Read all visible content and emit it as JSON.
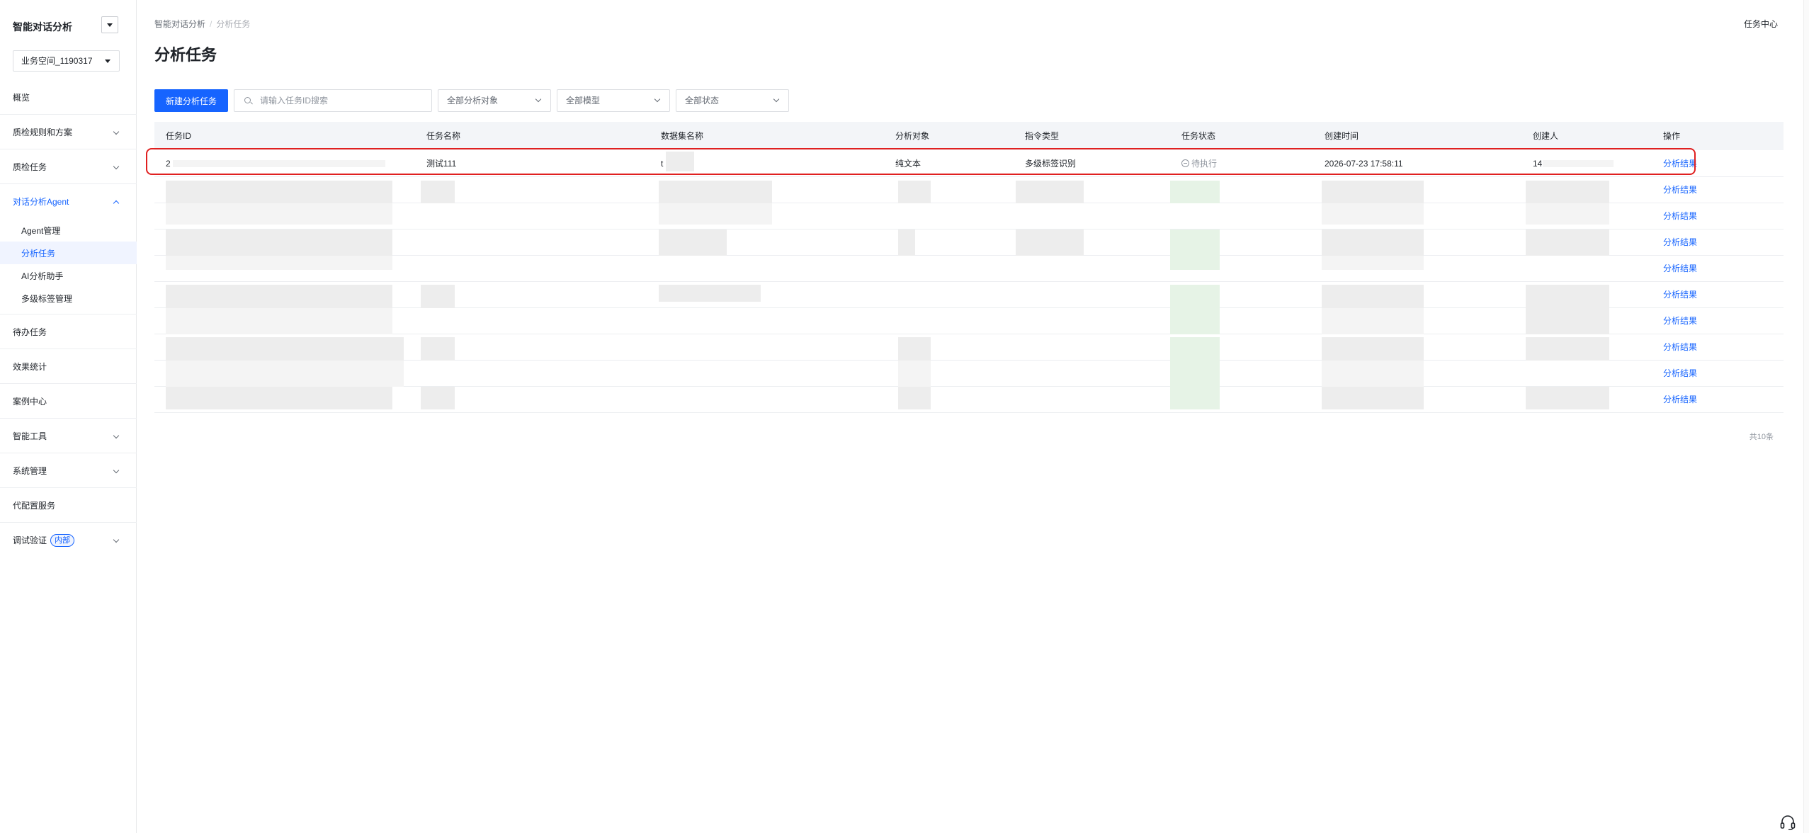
{
  "sidebar": {
    "app_title": "智能对话分析",
    "workspace": "业务空间_1190317",
    "nav": [
      {
        "label": "概览"
      },
      {
        "label": "质检规则和方案"
      },
      {
        "label": "质检任务"
      },
      {
        "label": "对话分析Agent"
      },
      {
        "label": "待办任务"
      },
      {
        "label": "效果统计"
      },
      {
        "label": "案例中心"
      },
      {
        "label": "智能工具"
      },
      {
        "label": "系统管理"
      },
      {
        "label": "代配置服务"
      },
      {
        "label": "调试验证"
      }
    ],
    "sub_items": [
      "Agent管理",
      "分析任务",
      "AI分析助手",
      "多级标签管理"
    ],
    "debug_badge": "内部"
  },
  "header": {
    "breadcrumb": [
      "智能对话分析",
      "分析任务"
    ],
    "task_center": "任务中心",
    "page_title": "分析任务"
  },
  "toolbar": {
    "new_task_label": "新建分析任务",
    "search_placeholder": "请输入任务ID搜索",
    "filter_object": "全部分析对象",
    "filter_model": "全部模型",
    "filter_status": "全部状态"
  },
  "table": {
    "columns": [
      "任务ID",
      "任务名称",
      "数据集名称",
      "分析对象",
      "指令类型",
      "任务状态",
      "创建时间",
      "创建人",
      "操作"
    ],
    "first_row": {
      "task_id": "2",
      "task_name": "测试111",
      "dataset": "t",
      "object": "纯文本",
      "instruction": "多级标签识别",
      "status": "待执行",
      "created_at": "2026-07-23 17:58:11",
      "creator": "14",
      "action": "分析结果"
    },
    "action_label": "分析结果",
    "total": "共10条"
  },
  "colors": {
    "primary": "#1664ff",
    "highlight": "#e02020"
  },
  "icons": [
    "collapse-icon",
    "search-icon",
    "chevron-down-icon",
    "chevron-up-icon",
    "status-pending-icon",
    "headset-icon"
  ]
}
